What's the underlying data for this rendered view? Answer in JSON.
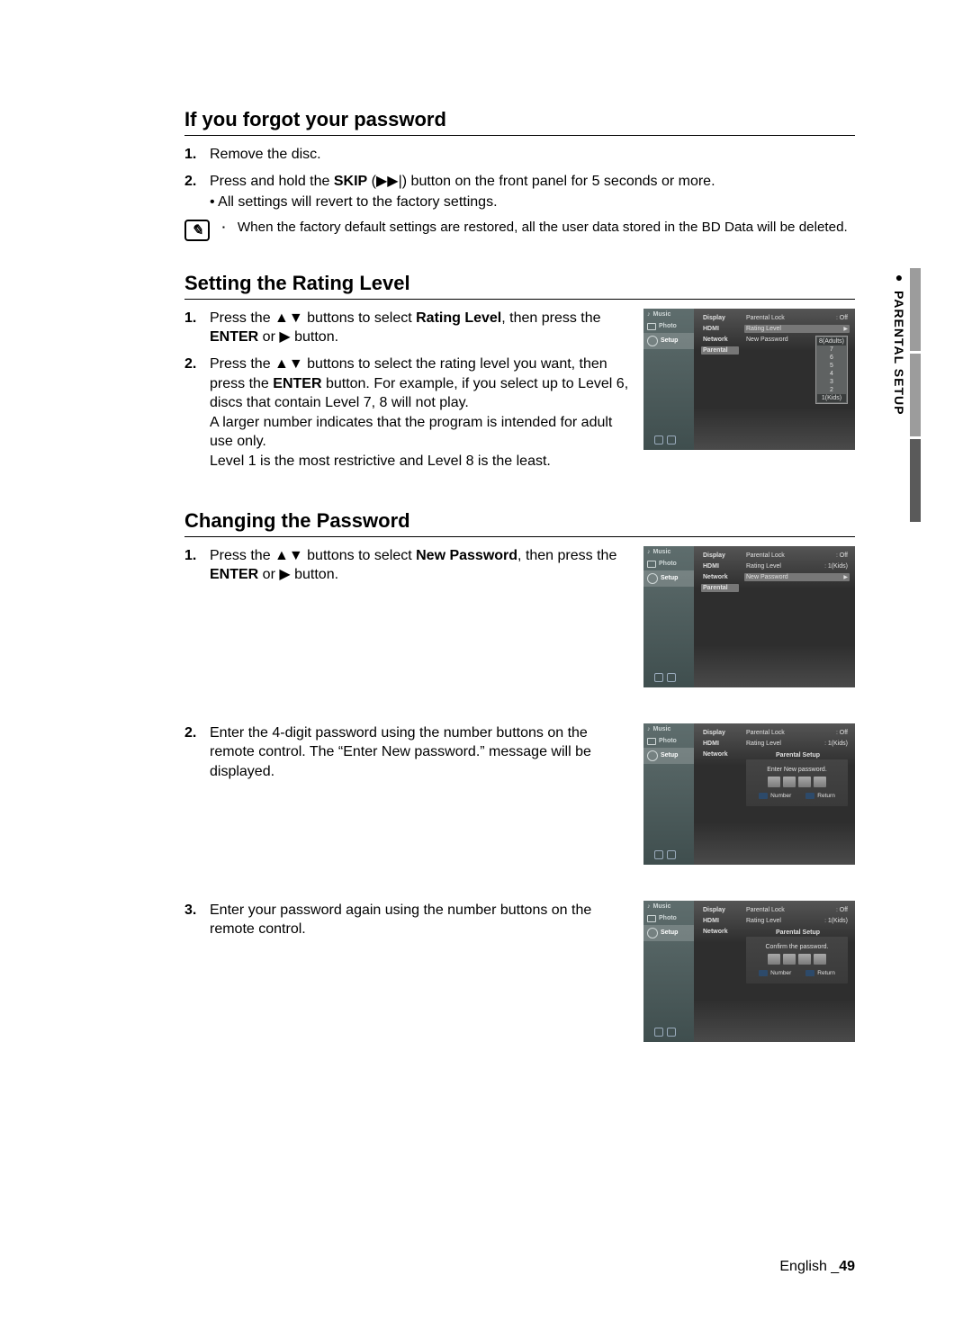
{
  "side_tab": "PARENTAL SETUP",
  "sections": {
    "forgot": {
      "title": "If you forgot your password",
      "steps": [
        {
          "n": "1.",
          "t": "Remove the disc."
        },
        {
          "n": "2.",
          "preA": "Press and hold the ",
          "skip": "SKIP",
          "preB": " (",
          "icon": "▶▶|",
          "t": ") button on the front panel for 5 seconds or more.",
          "sub": "• All settings will revert to the factory settings."
        }
      ],
      "note": "When the factory default settings are restored, all the user data stored in the BD Data will be deleted."
    },
    "rating": {
      "title": "Setting the Rating Level",
      "steps": [
        {
          "n": "1.",
          "pre": "Press the ▲▼ buttons to select ",
          "bold": "Rating Level",
          "mid": ", then press the ",
          "bold2": "ENTER",
          "post": " or ▶ button."
        },
        {
          "n": "2.",
          "pre": "Press the ▲▼ buttons to select the rating level you want, then press the ",
          "bold": "ENTER",
          "post": " button. For example, if you select up to Level 6, discs that contain Level 7, 8 will not play.",
          "extra1": "A larger number indicates that the program is intended for adult use only.",
          "extra2": "Level 1 is the most restrictive and Level 8 is the least."
        }
      ]
    },
    "changing": {
      "title": "Changing the Password",
      "steps": [
        {
          "n": "1.",
          "pre": "Press the ▲▼ buttons to select ",
          "bold": "New Password",
          "mid": ", then press the ",
          "bold2": "ENTER",
          "post": " or ▶ button."
        },
        {
          "n": "2.",
          "t": "Enter the 4-digit password using the number buttons on the remote control. The “Enter New password.” message will be displayed."
        },
        {
          "n": "3.",
          "t": "Enter your password again using the number buttons on the remote control."
        }
      ]
    }
  },
  "screen": {
    "sidebar": [
      {
        "icon": "♪",
        "label": "Music"
      },
      {
        "icon": "▢",
        "label": "Photo"
      },
      {
        "icon": "⚙",
        "label": "Setup",
        "sel": true
      }
    ],
    "menu1": [
      "Display",
      "HDMI",
      "Network",
      "Parental"
    ],
    "parental_lock": {
      "k": "Parental Lock",
      "v": "Off"
    },
    "rating_level": {
      "k": "Rating Level",
      "v8": "8(Adults)",
      "v1": "1(Kids)"
    },
    "new_password": "New Password",
    "parental_setup": "Parental Setup",
    "dropdown": [
      "8(Adults)",
      "7",
      "6",
      "5",
      "4",
      "3",
      "2",
      "1(Kids)"
    ],
    "modal_enter": "Enter New password.",
    "modal_confirm": "Confirm the password.",
    "btn_number": "Number",
    "btn_return": "Return"
  },
  "footer": {
    "lang": "English _",
    "page": "49"
  }
}
